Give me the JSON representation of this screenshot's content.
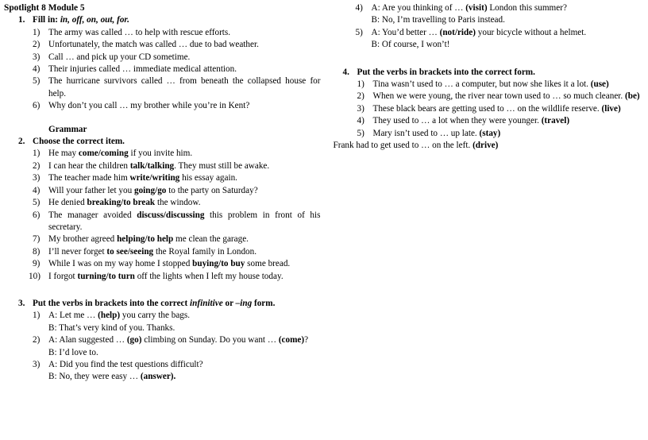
{
  "document": {
    "title": "Spotlight 8 Module 5",
    "subheading_grammar": "Grammar"
  },
  "exercises": [
    {
      "number": "1.",
      "heading_prefix": "Fill in:",
      "heading_italic": "in, off, on, out, for.",
      "items": [
        {
          "num": "1)",
          "text": "The army was called … to help with rescue efforts."
        },
        {
          "num": "2)",
          "text": "Unfortunately, the match was called … due to bad weather."
        },
        {
          "num": "3)",
          "text": "Call … and pick up your CD sometime."
        },
        {
          "num": "4)",
          "text": "Their injuries called … immediate medical attention."
        },
        {
          "num": "5)",
          "text": "The hurricane survivors called … from beneath the collapsed house for help."
        },
        {
          "num": "6)",
          "text": "Why don’t you call … my brother while you’re in Kent?"
        }
      ]
    },
    {
      "number": "2.",
      "heading": "Choose the correct item.",
      "items": [
        {
          "num": "1)",
          "pre": "He may ",
          "bold": "come/coming",
          "post": " if you invite him."
        },
        {
          "num": "2)",
          "pre": "I can hear the children ",
          "bold": "talk/talking",
          "post": ". They must still be awake."
        },
        {
          "num": "3)",
          "pre": "The teacher made him ",
          "bold": "write/writing",
          "post": " his essay again."
        },
        {
          "num": "4)",
          "pre": "Will your father let you ",
          "bold": "going/go",
          "post": " to the party on Saturday?"
        },
        {
          "num": "5)",
          "pre": "He denied ",
          "bold": "breaking/to break",
          "post": " the window."
        },
        {
          "num": "6)",
          "pre": "The manager avoided ",
          "bold": "discuss/discussing",
          "post": " this problem in front of his secretary."
        },
        {
          "num": "7)",
          "pre": "My brother agreed ",
          "bold": "helping/to help",
          "post": " me clean the garage."
        },
        {
          "num": "8)",
          "pre": "I’ll never forget ",
          "bold": "to see/seeing",
          "post": " the Royal family in London."
        },
        {
          "num": "9)",
          "pre": "While I was on my way home I stopped ",
          "bold": "buying/to buy",
          "post": " some bread."
        },
        {
          "num": "10)",
          "pre": "I forgot ",
          "bold": "turning/to turn",
          "post": " off the lights when I left my house today."
        }
      ]
    },
    {
      "number": "3.",
      "heading_prefix": "Put the verbs in brackets into the correct",
      "heading_italic_1": "infinitive",
      "heading_mid": "or",
      "heading_italic_2": "–ing",
      "heading_suffix": "form.",
      "items": [
        {
          "num": "1)",
          "line_a": "A: Let me … (help) you carry the bags.",
          "line_a_pre": "A: Let me … ",
          "line_a_bold": "(help)",
          "line_a_post": " you carry the bags.",
          "line_b": "B: That’s very kind of you. Thanks."
        },
        {
          "num": "2)",
          "line_a_pre": "A: Alan suggested … ",
          "line_a_bold": "(go)",
          "line_a_mid": " climbing on Sunday. Do you want … ",
          "line_a_bold2": "(come)",
          "line_a_post": "?",
          "line_b": "B: I’d love to."
        },
        {
          "num": "3)",
          "line_a_pre": "A: Did you find the test questions difficult?",
          "line_b_pre": "B: No, they were easy … ",
          "line_b_bold": "(answer).",
          "line_b_post": ""
        },
        {
          "num": "4)",
          "line_a_pre": "A: Are you thinking of … ",
          "line_a_bold": "(visit)",
          "line_a_post": " London this summer?",
          "line_b": "B: No, I’m travelling to Paris instead."
        },
        {
          "num": "5)",
          "line_a_pre": "A: You’d better … ",
          "line_a_bold": "(not/ride)",
          "line_a_post": " your bicycle without a helmet.",
          "line_b": "B: Of course, I won’t!"
        }
      ]
    },
    {
      "number": "4.",
      "heading": "Put the verbs in brackets into the correct form.",
      "items": [
        {
          "num": "1)",
          "pre": "Tina wasn’t used to … a computer, but now she likes it a lot. ",
          "bold": "(use)",
          "post": ""
        },
        {
          "num": "2)",
          "pre": "When we were young, the river near town used to … so much cleaner. ",
          "bold": "(be)",
          "post": ""
        },
        {
          "num": "3)",
          "pre": "These black bears are getting used to … on the wildlife reserve. ",
          "bold": "(live)",
          "post": ""
        },
        {
          "num": "4)",
          "pre": "They used to … a lot when they were younger. ",
          "bold": "(travel)",
          "post": ""
        },
        {
          "num": "5)",
          "pre": "Mary isn’t used to … up late. ",
          "bold": "(stay)",
          "post": ""
        }
      ],
      "trailing_line_pre": "Frank had to get used to … on the left. ",
      "trailing_line_bold": "(drive)"
    }
  ]
}
